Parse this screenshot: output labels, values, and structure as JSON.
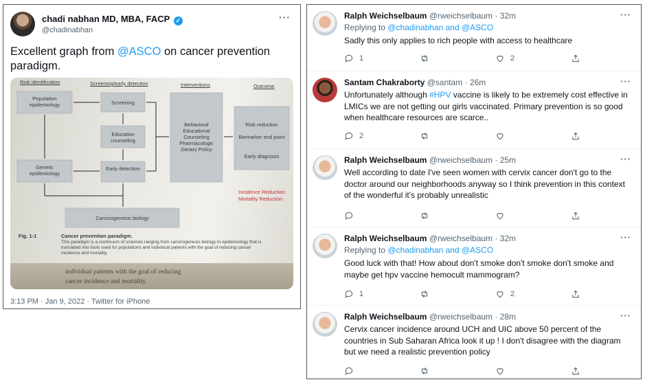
{
  "main_tweet": {
    "author_name": "chadi nabhan MD, MBA, FACP",
    "verified_mark": "✓",
    "handle": "@chadinabhan",
    "text_before": "Excellent graph from ",
    "mention": "@ASCO",
    "text_after": " on cancer prevention paradigm.",
    "timestamp": "3:13 PM · Jan 9, 2022 · Twitter for iPhone",
    "more_label": "···",
    "image": {
      "headers": [
        "Risk identification",
        "Screening/early detection",
        "Interventions",
        "Outcome"
      ],
      "boxes": {
        "population": "Population epidemiology",
        "screening": "Screening",
        "education": "Education counseling",
        "behavioral": "Behavioral Educational Counseling Pharmacologic Dietary Policy",
        "genetic": "Genetic epidemiology",
        "early": "Early detection",
        "carcinogenesis": "Carcinogenesis biology",
        "outcomes": [
          "Risk reduction",
          "Biomarker end point",
          "Early diagnosis"
        ]
      },
      "red_text": [
        "Incidence Reduction",
        "Mortality Reduction"
      ],
      "fig_label": "Fig. 1-1",
      "caption_title": "Cancer prevention paradigm.",
      "caption_lines": [
        "This paradigm is a continuum of sciences ranging from carcinogenesis biology to epidemiology that is",
        "translated into tools used for populations and individual patients with the goal of reducing cancer",
        "incidence and mortality."
      ],
      "lower_text": [
        "individual patients with the goal of reducing",
        "cancer incidence and mortality."
      ]
    }
  },
  "replies": [
    {
      "name": "Ralph Weichselbaum",
      "meta": "@rweichselbaum · 32m",
      "replying_to": [
        "Replying to ",
        "@chadinabhan and @ASCO"
      ],
      "text": "Sadly this only applies to rich people with access to healthcare",
      "counts": {
        "reply": "1",
        "retweet": "",
        "like": "2"
      }
    },
    {
      "name": "Santam Chakraborty",
      "meta": "@santam · 26m",
      "text_parts": [
        "Unfortunately although ",
        "#HPV",
        " vaccine is likely to be extremely cost effective in LMICs we are not getting our girls vaccinated. Primary prevention is so good when healthcare resources are scarce.."
      ],
      "counts": {
        "reply": "2",
        "retweet": "",
        "like": ""
      }
    },
    {
      "name": "Ralph Weichselbaum",
      "meta": "@rweichselbaum · 25m",
      "text": "Well according to date I've seen women with cervix cancer don't go to the doctor around our neighborhoods anyway so I think prevention in this context of the wonderful it's probably unrealistic",
      "counts": {
        "reply": "",
        "retweet": "",
        "like": ""
      }
    },
    {
      "name": "Ralph Weichselbaum",
      "meta": "@rweichselbaum · 32m",
      "replying_to": [
        "Replying to ",
        "@chadinabhan and @ASCO"
      ],
      "text": "Good luck with that! How about don't smoke don't smoke don't smoke and maybe get hpv vaccine hemocult mammogram?",
      "counts": {
        "reply": "1",
        "retweet": "",
        "like": "2"
      }
    },
    {
      "name": "Ralph Weichselbaum",
      "meta": "@rweichselbaum · 28m",
      "text": "Cervix cancer incidence around UCH and UIC above 50 percent of the countries in Sub Saharan Africa look it up ! I don't disagree with the diagram but we need a realistic prevention policy",
      "counts": {
        "reply": "",
        "retweet": "",
        "like": ""
      }
    }
  ]
}
